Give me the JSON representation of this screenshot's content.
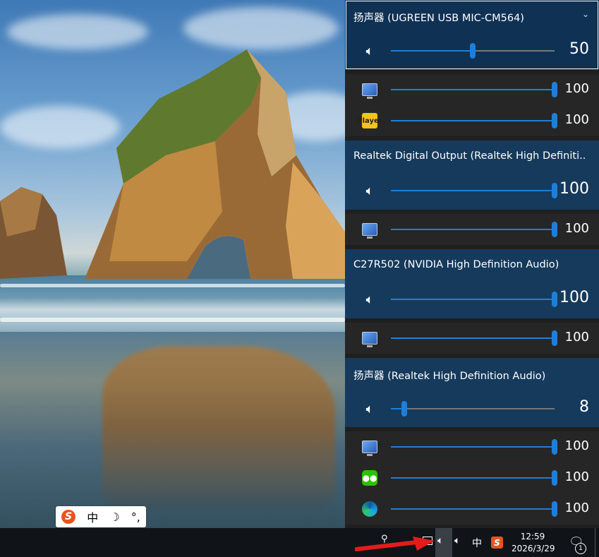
{
  "devices": [
    {
      "title": "扬声器 (UGREEN USB MIC-CM564)",
      "expanded": true,
      "master": {
        "value": "50",
        "level": 50
      },
      "apps": [
        {
          "icon": "system-sounds-icon",
          "value": "100",
          "level": 100
        },
        {
          "icon": "potplayer-icon",
          "value": "100",
          "level": 100
        }
      ]
    },
    {
      "title": "Realtek Digital Output (Realtek High Definiti...",
      "master": {
        "value": "100",
        "level": 100
      },
      "apps": [
        {
          "icon": "system-sounds-icon",
          "value": "100",
          "level": 100
        }
      ]
    },
    {
      "title": "C27R502 (NVIDIA High Definition Audio)",
      "master": {
        "value": "100",
        "level": 100
      },
      "apps": [
        {
          "icon": "system-sounds-icon",
          "value": "100",
          "level": 100
        }
      ]
    },
    {
      "title": "扬声器 (Realtek High Definition Audio)",
      "master": {
        "value": "8",
        "level": 8
      },
      "apps": [
        {
          "icon": "system-sounds-icon",
          "value": "100",
          "level": 100
        },
        {
          "icon": "wechat-icon",
          "value": "100",
          "level": 100
        },
        {
          "icon": "edge-icon",
          "value": "100",
          "level": 100
        }
      ]
    }
  ],
  "ime": {
    "logo": "S",
    "mode": "中",
    "moon": "☽",
    "punct": "°,"
  },
  "taskbar": {
    "ime_mode": "中",
    "sogou": "S",
    "time": "12:59",
    "date": "2026/3/29",
    "notifications": "1"
  },
  "potplayer_label": "Player"
}
